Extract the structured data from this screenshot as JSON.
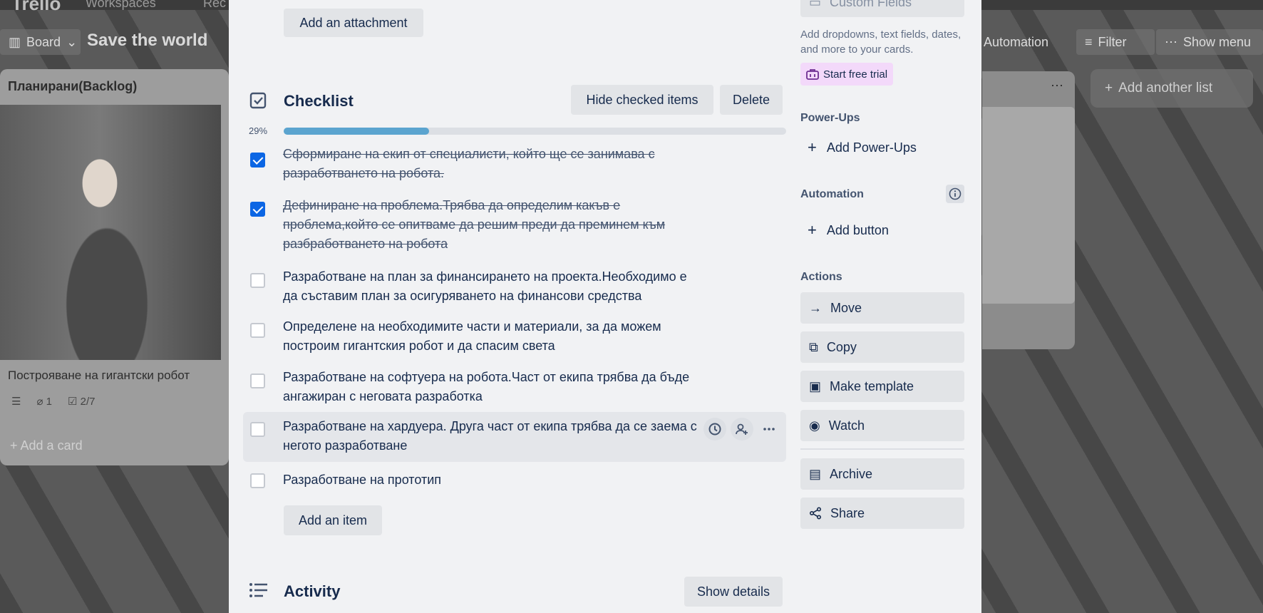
{
  "topbar": {
    "logo": "Trello",
    "workspaces": "Workspaces",
    "recent": "Rec"
  },
  "board": {
    "view_label": "Board",
    "title": "Save the world",
    "automation": "Automation",
    "filter": "Filter",
    "show_menu": "Show menu",
    "add_another_list": "Add another list"
  },
  "list": {
    "title": "Планирани(Backlog)",
    "card_title": "Построяване на гигантски робот",
    "attachments": "1",
    "checklist_count": "2/7",
    "add_card": "Add a card"
  },
  "modal": {
    "add_attachment": "Add an attachment",
    "checklist": {
      "title": "Checklist",
      "hide_checked": "Hide checked items",
      "delete": "Delete",
      "progress_label": "29%",
      "progress": 0.29,
      "items": [
        {
          "text": "Сформиране на екип от специалисти, който ще се занимава с разработването на робота.",
          "checked": true
        },
        {
          "text": "Дефиниране на проблема.Трябва да определим какъв е проблема,който се опитваме да решим преди да преминем към разбработването на робота",
          "checked": true
        },
        {
          "text": "Разработване на план за финансирането на проекта.Необходимо е да съставим план за осигуряването на финансови средства",
          "checked": false
        },
        {
          "text": "Определене на необходимите части и материали, за да можем построим гигантския робот и да спасим света",
          "checked": false
        },
        {
          "text": "Разработване на софтуера на робота.Част от екипа трябва да бъде ангажиран с неговата разработка",
          "checked": false
        },
        {
          "text": "Разработване на хардуера. Друга част от екипа трябва да се заема с негото разработване",
          "checked": false
        },
        {
          "text": "Разработване на прототип",
          "checked": false
        }
      ],
      "add_item": "Add an item"
    },
    "activity": {
      "title": "Activity",
      "show_details": "Show details"
    }
  },
  "sidebar": {
    "custom_fields": "Custom Fields",
    "custom_fields_note": "Add dropdowns, text fields, dates, and more to your cards.",
    "start_trial": "Start free trial",
    "powerups_label": "Power-Ups",
    "add_powerups": "Add Power-Ups",
    "automation_label": "Automation",
    "add_button": "Add button",
    "actions_label": "Actions",
    "actions": {
      "move": "Move",
      "copy": "Copy",
      "make_template": "Make template",
      "watch": "Watch",
      "archive": "Archive",
      "share": "Share"
    }
  },
  "colors": {
    "check_blue": "#0c66e4",
    "progress": "#5ba4cf",
    "trial_bg": "#f3d9fa",
    "modal_bg": "#f1f2f4"
  }
}
